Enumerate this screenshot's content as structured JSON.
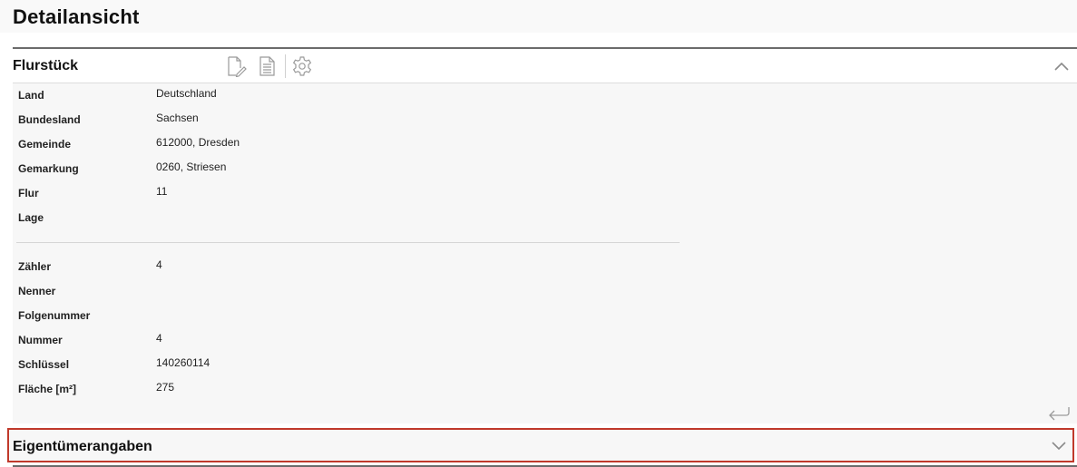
{
  "page": {
    "title": "Detailansicht"
  },
  "flurstueck": {
    "title": "Flurstück",
    "tools": [
      {
        "icon": "edit-document-icon"
      },
      {
        "icon": "document-icon"
      },
      {
        "icon": "gear-icon"
      }
    ],
    "collapse_icon": "chevron-up-icon",
    "section1": [
      {
        "label": "Land",
        "value": "Deutschland"
      },
      {
        "label": "Bundesland",
        "value": "Sachsen"
      },
      {
        "label": "Gemeinde",
        "value": "612000, Dresden"
      },
      {
        "label": "Gemarkung",
        "value": "0260, Striesen"
      },
      {
        "label": "Flur",
        "value": "11"
      },
      {
        "label": "Lage",
        "value": ""
      }
    ],
    "section2": [
      {
        "label": "Zähler",
        "value": "4"
      },
      {
        "label": "Nenner",
        "value": ""
      },
      {
        "label": "Folgenummer",
        "value": ""
      },
      {
        "label": "Nummer",
        "value": "4"
      },
      {
        "label": "Schlüssel",
        "value": "140260114"
      },
      {
        "label": "Fläche [m²]",
        "value": "275"
      }
    ],
    "return_icon": "return-icon"
  },
  "eigentuemer": {
    "title": "Eigentümerangaben",
    "expand_icon": "chevron-down-icon"
  },
  "colors": {
    "highlight_border": "#c0392b",
    "panel_border": "#6b6b6b",
    "icon": "#9a9a9a"
  }
}
